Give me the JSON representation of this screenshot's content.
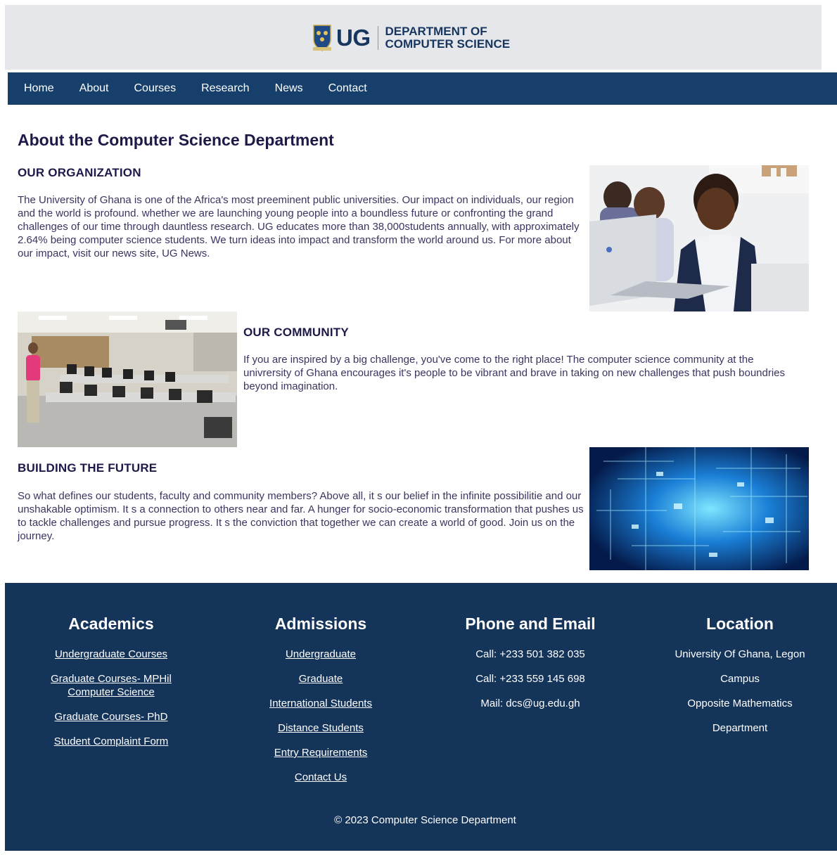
{
  "header": {
    "logo_text": "UG",
    "dept_line1": "DEPARTMENT OF",
    "dept_line2": "COMPUTER SCIENCE",
    "crest_icon": "university-crest-icon",
    "brand_color": "#16365f"
  },
  "nav": {
    "items": [
      "Home",
      "About",
      "Courses",
      "Research",
      "News",
      "Contact"
    ],
    "background": "#16406b"
  },
  "main": {
    "title": "About the Computer Science Department",
    "organization": {
      "heading": "OUR ORGANIZATION",
      "text": "The University of Ghana is one of the Africa's most preeminent public universities. Our impact on individuals, our region and the world is profound. whether we are launching young people into a boundless future or confronting the grand challenges of our time through dauntless research. UG educates more than 38,000students annually, with approximately 2.64% being computer science students. We turn ideas into impact and transform the world around us. For more about our impact, visit our news site, UG News."
    },
    "community": {
      "heading": "OUR COMMUNITY",
      "text": "If you are inspired by a big challenge, you've come to the right place! The computer science community at the univrersity of Ghana encourages it's people to be vibrant and brave in taking on new challenges that push boundries beyond imagination."
    },
    "future": {
      "heading": "BUILDING THE FUTURE",
      "text": "So what defines our students, faculty and community members? Above all, it   s our belief in the infinite possibilitie and our unshakable optimism. It   s a connection to others near and far. A hunger for socio-economic transformation that pushes us to tackle challenges and pursue progress. It   s the conviction that together we can create a world of good. Join us on the journey."
    }
  },
  "footer": {
    "background": "#14345a",
    "academics": {
      "heading": "Academics",
      "links": [
        "Undergraduate Courses",
        "Graduate Courses- MPHil Computer Science",
        "Graduate Courses- PhD",
        "Student Complaint Form"
      ]
    },
    "admissions": {
      "heading": "Admissions",
      "links": [
        "Undergraduate",
        "Graduate",
        "International Students",
        "Distance Students",
        "Entry Requirements",
        "Contact Us"
      ]
    },
    "contact": {
      "heading": "Phone and Email",
      "lines": [
        "Call: +233 501 382 035",
        "Call: +233 559 145 698",
        "Mail: dcs@ug.edu.gh"
      ]
    },
    "location": {
      "heading": "Location",
      "lines": [
        "University Of Ghana, Legon",
        "Campus",
        "Opposite Mathematics",
        "Department"
      ]
    },
    "copyright": "© 2023 Computer Science Department"
  }
}
